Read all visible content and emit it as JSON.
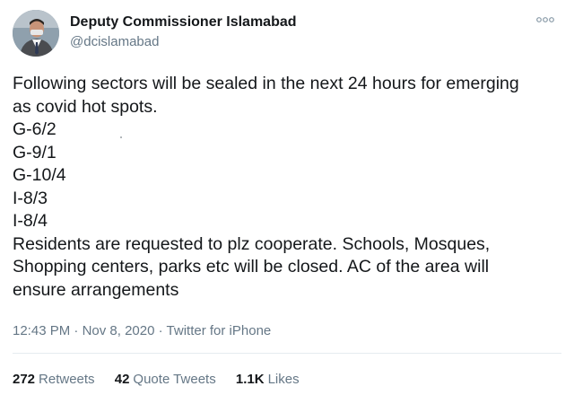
{
  "author": {
    "name": "Deputy Commissioner Islamabad",
    "handle": "@dcislamabad"
  },
  "tweet": {
    "lines": [
      "Following sectors will be sealed in the next 24 hours for emerging",
      "as covid hot spots.",
      "G-6/2",
      "G-9/1",
      "G-10/4",
      "I-8/3",
      "I-8/4",
      "Residents are requested to plz cooperate. Schools, Mosques,",
      "Shopping centers, parks etc will be closed. AC of the area will",
      "ensure arrangements"
    ]
  },
  "meta": {
    "time": "12:43 PM",
    "separator": "·",
    "date": "Nov 8, 2020",
    "source": "Twitter for iPhone"
  },
  "stats": {
    "retweets_count": "272",
    "retweets_label": "Retweets",
    "quotes_count": "42",
    "quotes_label": "Quote Tweets",
    "likes_count": "1.1K",
    "likes_label": "Likes"
  },
  "icons": {
    "more": "more-options-icon",
    "avatar": "profile-avatar"
  },
  "colors": {
    "text_primary": "#14171a",
    "text_secondary": "#657786",
    "divider": "#e6ecf0"
  }
}
